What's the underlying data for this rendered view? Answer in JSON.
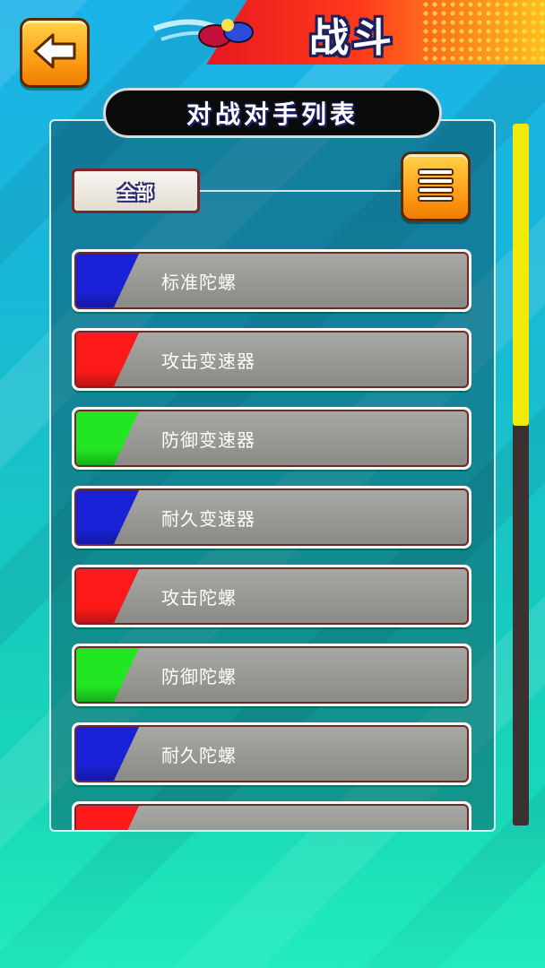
{
  "header": {
    "title": "战斗",
    "back_icon": "arrow-left-icon",
    "banner_colors": [
      "#e8181f",
      "#ffc21d"
    ]
  },
  "panel": {
    "title": "对战对手列表",
    "filter_label": "全部",
    "menu_icon": "hamburger-menu-icon"
  },
  "opponents": [
    {
      "label": "标准陀螺",
      "color": "#1a22d8"
    },
    {
      "label": "攻击变速器",
      "color": "#ff1a1a"
    },
    {
      "label": "防御变速器",
      "color": "#22e622"
    },
    {
      "label": "耐久变速器",
      "color": "#1a22d8"
    },
    {
      "label": "攻击陀螺",
      "color": "#ff1a1a"
    },
    {
      "label": "防御陀螺",
      "color": "#22e622"
    },
    {
      "label": "耐久陀螺",
      "color": "#1a22d8"
    },
    {
      "label": "",
      "color": "#ff1a1a"
    }
  ],
  "scroll": {
    "position": 0,
    "visible_fraction": 0.43,
    "thumb_color": "#f1ea0a"
  }
}
